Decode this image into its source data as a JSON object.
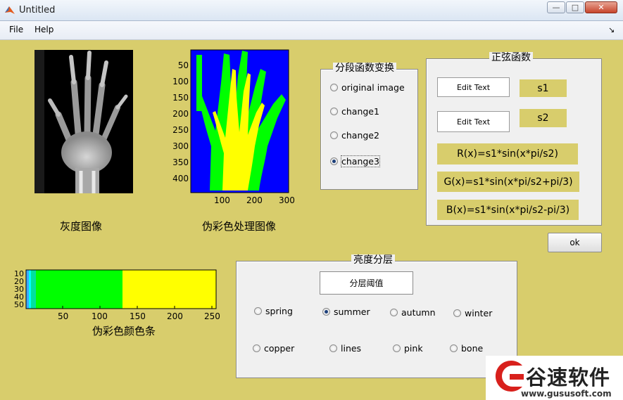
{
  "window": {
    "title": "Untitled",
    "min_glyph": "—",
    "max_glyph": "□",
    "close_glyph": "✕"
  },
  "menu": {
    "items": [
      "File",
      "Help"
    ],
    "dock_glyph": "↘"
  },
  "images": {
    "gray_caption": "灰度图像",
    "pseudo_caption": "伪彩色处理图像",
    "pseudo_axes": {
      "yticks": [
        "50",
        "100",
        "150",
        "200",
        "250",
        "300",
        "350",
        "400"
      ],
      "xticks": [
        "100",
        "200",
        "300"
      ]
    },
    "colorbar_caption": "伪彩色颜色条",
    "colorbar_axes": {
      "yticks": [
        "10",
        "20",
        "30",
        "40",
        "50"
      ],
      "xticks": [
        "50",
        "100",
        "150",
        "200",
        "250"
      ]
    }
  },
  "segment_panel": {
    "title": "分段函数变换",
    "options": [
      "original image",
      "change1",
      "change2",
      "change3"
    ],
    "selected": 3
  },
  "sine_panel": {
    "title": "正弦函数",
    "edit1": "Edit Text",
    "edit2": "Edit Text",
    "s1": "s1",
    "s2": "s2",
    "r_formula": "R(x)=s1*sin(x*pi/s2)",
    "g_formula": "G(x)=s1*sin(x*pi/s2+pi/3)",
    "b_formula": "B(x)=s1*sin(x*pi/s2-pi/3)"
  },
  "ok_button": "ok",
  "brightness_panel": {
    "title": "亮度分层",
    "threshold_button": "分层阈值",
    "colormaps": [
      "spring",
      "summer",
      "autumn",
      "winter",
      "copper",
      "lines",
      "pink",
      "bone"
    ],
    "selected": 1
  },
  "watermark": {
    "brand": "谷速软件",
    "url": "www.gususoft.com"
  },
  "colors": {
    "figure_bg": "#d8cd6c",
    "blue": "#0000ff",
    "green": "#00ff00",
    "yellow": "#ffff00"
  }
}
